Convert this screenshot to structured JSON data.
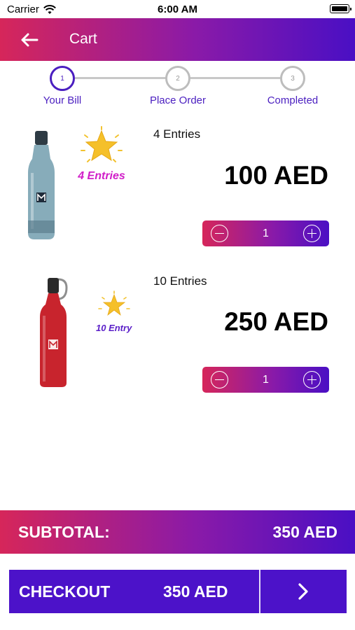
{
  "status_bar": {
    "carrier": "Carrier",
    "time": "6:00 AM"
  },
  "header": {
    "title": "Cart",
    "back_icon": "arrow-left-icon"
  },
  "stepper": {
    "steps": [
      {
        "number": "1",
        "label": "Your Bill",
        "active": true
      },
      {
        "number": "2",
        "label": "Place Order",
        "active": false
      },
      {
        "number": "3",
        "label": "Completed",
        "active": false
      }
    ]
  },
  "cart": {
    "items": [
      {
        "badge": "4 Entries",
        "entries": "4 Entries",
        "price": "100 AED",
        "quantity": "1",
        "product_color": "#6f94a4"
      },
      {
        "badge": "10 Entry",
        "entries": "10 Entries",
        "price": "250 AED",
        "quantity": "1",
        "product_color": "#c8242d"
      }
    ]
  },
  "subtotal": {
    "label": "SUBTOTAL:",
    "value": "350 AED"
  },
  "checkout": {
    "label": "CHECKOUT",
    "amount": "350 AED",
    "arrow_icon": "chevron-right-icon"
  },
  "colors": {
    "gradient_start": "#d6265a",
    "gradient_end": "#4a0fc4",
    "primary": "#4c12c9",
    "badge_pink": "#d11ec8",
    "badge_purple": "#5a1ec8"
  }
}
